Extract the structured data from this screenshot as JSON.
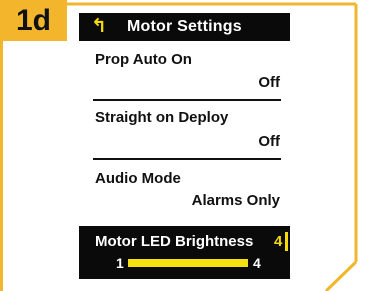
{
  "step_badge": "1d",
  "header": {
    "back_icon": "back-arrow-icon",
    "title": "Motor Settings"
  },
  "settings": [
    {
      "label": "Prop Auto On",
      "value": "Off"
    },
    {
      "label": "Straight on Deploy",
      "value": "Off"
    },
    {
      "label": "Audio Mode",
      "value": "Alarms Only"
    }
  ],
  "led_brightness": {
    "label": "Motor LED Brightness",
    "value": "4",
    "slider_min": "1",
    "slider_max": "4",
    "level_fraction": 1.0
  },
  "colors": {
    "accent_gold": "#f3b52c",
    "highlight_yellow": "#f5d90a",
    "screen_black": "#0a0a0a"
  }
}
